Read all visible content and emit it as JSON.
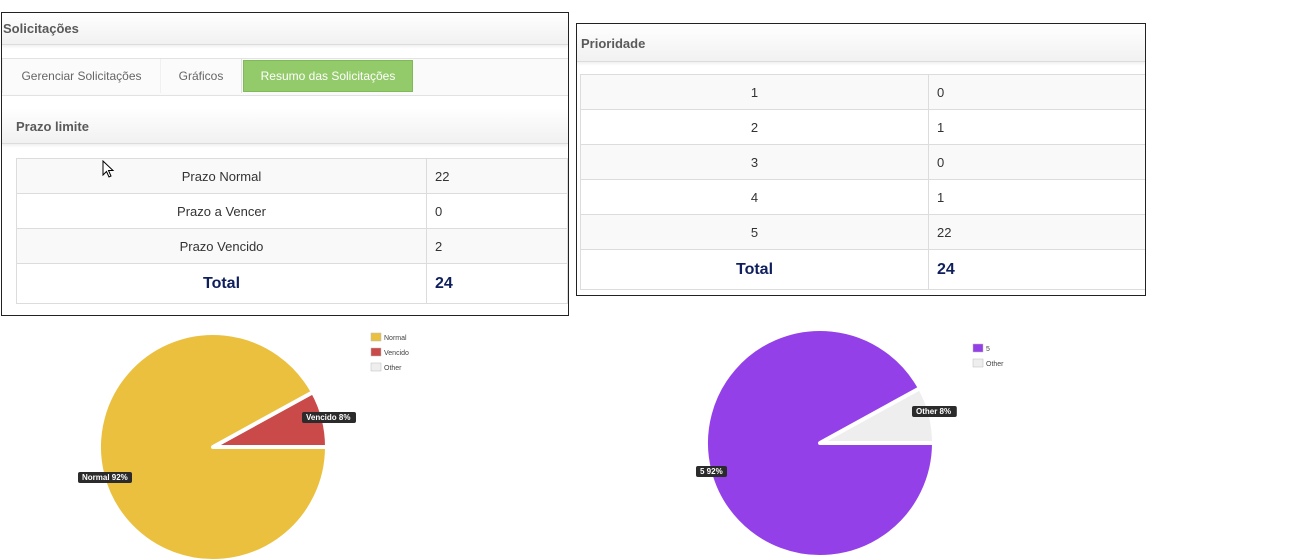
{
  "left": {
    "header": "Solicitações",
    "tabs": [
      {
        "label": "Gerenciar Solicitações",
        "active": false
      },
      {
        "label": "Gráficos",
        "active": false
      },
      {
        "label": "Resumo das Solicitações",
        "active": true
      }
    ],
    "section_title": "Prazo limite",
    "rows": [
      {
        "name": "Prazo Normal",
        "value": "22"
      },
      {
        "name": "Prazo a Vencer",
        "value": "0"
      },
      {
        "name": "Prazo Vencido",
        "value": "2"
      }
    ],
    "total": {
      "name": "Total",
      "value": "24"
    }
  },
  "right": {
    "header": "Prioridade",
    "rows": [
      {
        "name": "1",
        "value": "0"
      },
      {
        "name": "2",
        "value": "1"
      },
      {
        "name": "3",
        "value": "0"
      },
      {
        "name": "4",
        "value": "1"
      },
      {
        "name": "5",
        "value": "22"
      }
    ],
    "total": {
      "name": "Total",
      "value": "24"
    }
  },
  "colors": {
    "tab_active": "#93cb6a",
    "total_text": "#0f1f5c"
  },
  "chart_data": [
    {
      "type": "pie",
      "slices": [
        {
          "name": "Normal",
          "value": 92,
          "label": "Normal 92%",
          "color": "#ebc03f"
        },
        {
          "name": "Vencido",
          "value": 8,
          "label": "Vencido 8%",
          "color": "#c94a48"
        },
        {
          "name": "Other",
          "value": 0,
          "label": "",
          "color": "#eeeeee"
        }
      ],
      "legend": [
        "Normal",
        "Vencido",
        "Other"
      ],
      "legend_position": "top-right"
    },
    {
      "type": "pie",
      "slices": [
        {
          "name": "5",
          "value": 92,
          "label": "5 92%",
          "color": "#9340e8"
        },
        {
          "name": "Other",
          "value": 8,
          "label": "Other 8%",
          "color": "#eeeeee"
        }
      ],
      "legend": [
        "5",
        "Other"
      ],
      "legend_position": "top-right"
    }
  ]
}
